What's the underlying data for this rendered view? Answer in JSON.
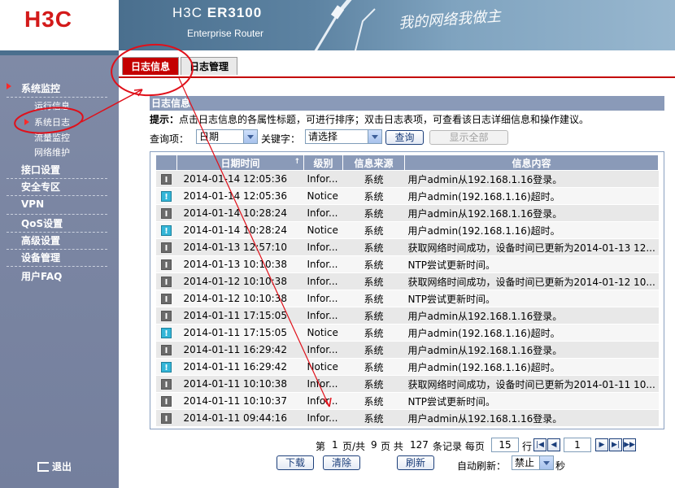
{
  "brand": {
    "logo": "H3C",
    "model_prefix": "H3C",
    "model": "ER3100",
    "subtitle": "Enterprise Router",
    "slogan": "我的网络我做主"
  },
  "sidebar": {
    "items": [
      {
        "label": "系统监控"
      },
      {
        "label": "接口设置"
      },
      {
        "label": "安全专区"
      },
      {
        "label": "VPN"
      },
      {
        "label": "QoS设置"
      },
      {
        "label": "高级设置"
      },
      {
        "label": "设备管理"
      },
      {
        "label": "用户FAQ"
      }
    ],
    "subitems": [
      {
        "label": "运行信息"
      },
      {
        "label": "系统日志"
      },
      {
        "label": "流量监控"
      },
      {
        "label": "网络维护"
      }
    ],
    "logout": "退出"
  },
  "tabs": [
    {
      "label": "日志信息"
    },
    {
      "label": "日志管理"
    }
  ],
  "section": {
    "title": "日志信息"
  },
  "hint": {
    "bold": "提示：",
    "text": "点击日志信息的各属性标题，可进行排序；双击日志表项，可查看该日志详细信息和操作建议。"
  },
  "filter": {
    "query_label": "查询项：",
    "query_value": "日期",
    "keyword_label": "关键字：",
    "keyword_value": "请选择",
    "search_button": "查询",
    "show_all_button": "显示全部"
  },
  "table": {
    "headers": {
      "date": "日期时间",
      "level": "级别",
      "source": "信息来源",
      "content": "信息内容"
    },
    "rows": [
      {
        "icon": "info",
        "date": "2014-01-14 12:05:36",
        "level": "Infor...",
        "source": "系统",
        "content": "用户admin从192.168.1.16登录。"
      },
      {
        "icon": "notice",
        "date": "2014-01-14 12:05:36",
        "level": "Notice",
        "source": "系统",
        "content": "用户admin(192.168.1.16)超时。"
      },
      {
        "icon": "info",
        "date": "2014-01-14 10:28:24",
        "level": "Infor...",
        "source": "系统",
        "content": "用户admin从192.168.1.16登录。"
      },
      {
        "icon": "notice",
        "date": "2014-01-14 10:28:24",
        "level": "Notice",
        "source": "系统",
        "content": "用户admin(192.168.1.16)超时。"
      },
      {
        "icon": "info",
        "date": "2014-01-13 12:57:10",
        "level": "Infor...",
        "source": "系统",
        "content": "获取网络时间成功，设备时间已更新为2014-01-13 12..."
      },
      {
        "icon": "info",
        "date": "2014-01-13 10:10:38",
        "level": "Infor...",
        "source": "系统",
        "content": "NTP尝试更新时间。"
      },
      {
        "icon": "info",
        "date": "2014-01-12 10:10:38",
        "level": "Infor...",
        "source": "系统",
        "content": "获取网络时间成功，设备时间已更新为2014-01-12 10..."
      },
      {
        "icon": "info",
        "date": "2014-01-12 10:10:38",
        "level": "Infor...",
        "source": "系统",
        "content": "NTP尝试更新时间。"
      },
      {
        "icon": "info",
        "date": "2014-01-11 17:15:05",
        "level": "Infor...",
        "source": "系统",
        "content": "用户admin从192.168.1.16登录。"
      },
      {
        "icon": "notice",
        "date": "2014-01-11 17:15:05",
        "level": "Notice",
        "source": "系统",
        "content": "用户admin(192.168.1.16)超时。"
      },
      {
        "icon": "info",
        "date": "2014-01-11 16:29:42",
        "level": "Infor...",
        "source": "系统",
        "content": "用户admin从192.168.1.16登录。"
      },
      {
        "icon": "notice",
        "date": "2014-01-11 16:29:42",
        "level": "Notice",
        "source": "系统",
        "content": "用户admin(192.168.1.16)超时。"
      },
      {
        "icon": "info",
        "date": "2014-01-11 10:10:38",
        "level": "Infor...",
        "source": "系统",
        "content": "获取网络时间成功，设备时间已更新为2014-01-11 10..."
      },
      {
        "icon": "info",
        "date": "2014-01-11 10:10:37",
        "level": "Infor...",
        "source": "系统",
        "content": "NTP尝试更新时间。"
      },
      {
        "icon": "info",
        "date": "2014-01-11 09:44:16",
        "level": "Infor...",
        "source": "系统",
        "content": "用户admin从192.168.1.16登录。"
      }
    ]
  },
  "pager": {
    "page_prefix": "第",
    "current_page": "1",
    "page_mid": "页/共",
    "total_pages": "9",
    "page_suffix": "页 共",
    "total_records": "127",
    "records_suffix": "条记录 每页",
    "per_page": "15",
    "row_suffix": "行",
    "goto_page": "1"
  },
  "actions": {
    "download": "下载",
    "clear": "清除",
    "refresh": "刷新",
    "auto_refresh_label": "自动刷新：",
    "auto_refresh_value": "禁止",
    "seconds": "秒"
  },
  "icons": {
    "info": "I",
    "notice": "!"
  },
  "colors": {
    "brand_red": "#d31a1a",
    "sidebar_bg": "#7f8aa6",
    "header_bg": "#8a9ab8",
    "annotation": "#e0101a",
    "tab_active": "#c40000"
  }
}
